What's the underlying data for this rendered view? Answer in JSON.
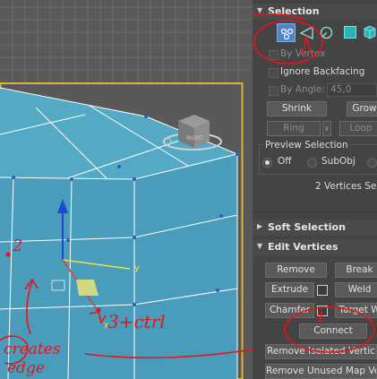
{
  "selection": {
    "title": "Selection",
    "by_vertex": "By Vertex",
    "ignore_backfacing": "Ignore Backfacing",
    "by_angle": "By Angle:",
    "by_angle_value": "45,0",
    "shrink": "Shrink",
    "grow": "Grow",
    "ring": "Ring",
    "loop": "Loop",
    "preview_selection": "Preview Selection",
    "preview_off": "Off",
    "preview_subobj": "SubObj",
    "status": "2 Vertices Sele",
    "active_subobject": "vertex"
  },
  "soft_selection": {
    "title": "Soft Selection"
  },
  "edit_vertices": {
    "title": "Edit Vertices",
    "remove": "Remove",
    "break": "Break",
    "extrude": "Extrude",
    "weld": "Weld",
    "chamfer": "Chamfer",
    "target_weld": "Target W",
    "connect": "Connect",
    "remove_isolated": "Remove Isolated Vertic",
    "remove_unused": "Remove Unused Map Ver"
  },
  "viewport": {
    "viewcube_label": "RIGHT",
    "gizmo_y_label": "y",
    "gizmo_x_label": "x"
  },
  "annotations": {
    "num_2": "2",
    "num_3_ctrl": "3+ctrl",
    "num_4": "4",
    "note_creates": "creates",
    "note_edge": "edge",
    "ink_color": "#e8131b"
  },
  "colors": {
    "mesh_face": "#4a9dba",
    "mesh_top": "#54a9c4",
    "panel_bg": "#444444",
    "grid_bg": "#595959",
    "active_icon": "#4f86c6",
    "teal_icon": "#28b3b8"
  }
}
